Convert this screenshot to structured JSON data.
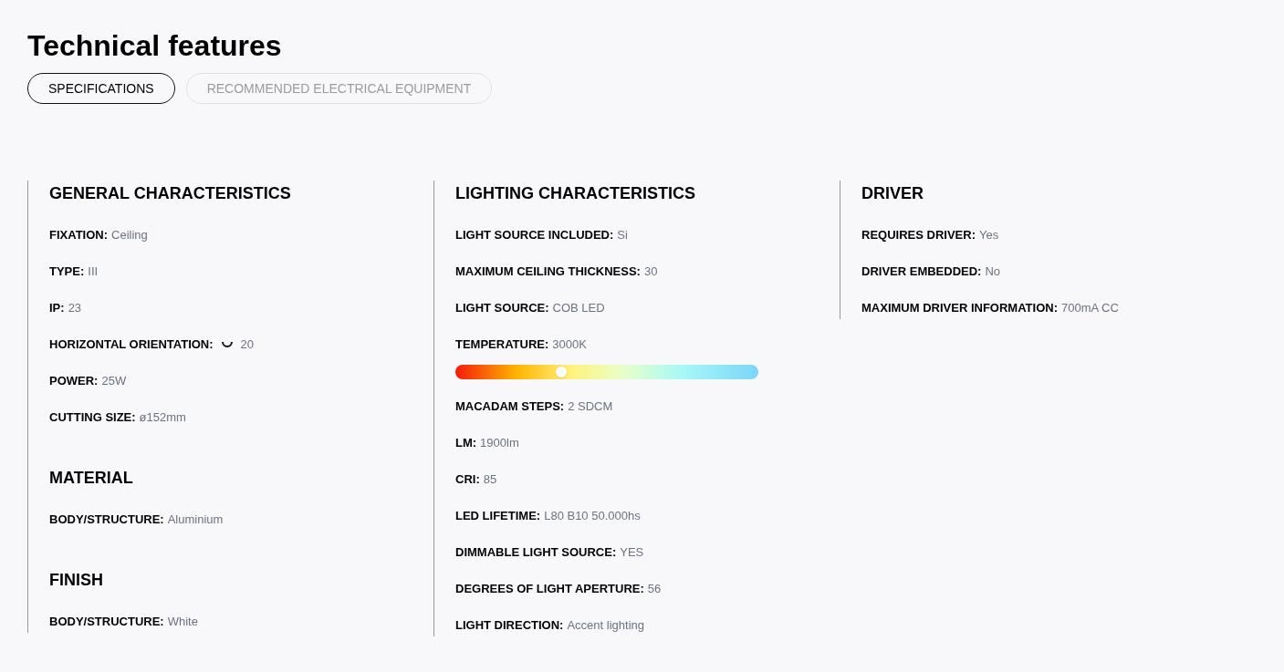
{
  "title": "Technical features",
  "tabs": [
    {
      "label": "SPECIFICATIONS",
      "selected": true
    },
    {
      "label": "RECOMMENDED ELECTRICAL EQUIPMENT",
      "selected": false
    }
  ],
  "columns": [
    {
      "sections": [
        {
          "title": "GENERAL CHARACTERISTICS",
          "rows": [
            {
              "kind": "text",
              "label": "FIXATION:",
              "value": "Ceiling"
            },
            {
              "kind": "text",
              "label": "TYPE:",
              "value": "III"
            },
            {
              "kind": "text",
              "label": "IP:",
              "value": "23"
            },
            {
              "kind": "orientation",
              "label": "HORIZONTAL ORIENTATION:",
              "value": "20"
            },
            {
              "kind": "text",
              "label": "POWER:",
              "value": "25W"
            },
            {
              "kind": "text",
              "label": "CUTTING SIZE:",
              "value": "ø152mm"
            }
          ]
        },
        {
          "title": "MATERIAL",
          "rows": [
            {
              "kind": "text",
              "label": "BODY/STRUCTURE:",
              "value": "Aluminium"
            }
          ]
        },
        {
          "title": "FINISH",
          "rows": [
            {
              "kind": "text",
              "label": "BODY/STRUCTURE:",
              "value": "White"
            }
          ]
        }
      ]
    },
    {
      "sections": [
        {
          "title": "LIGHTING CHARACTERISTICS",
          "rows": [
            {
              "kind": "text",
              "label": "LIGHT SOURCE INCLUDED:",
              "value": "Si"
            },
            {
              "kind": "text",
              "label": "MAXIMUM CEILING THICKNESS:",
              "value": "30"
            },
            {
              "kind": "text",
              "label": "LIGHT SOURCE:",
              "value": "COB LED"
            },
            {
              "kind": "temperature",
              "label": "TEMPERATURE:",
              "value": "3000K",
              "level": 0.35
            },
            {
              "kind": "text",
              "label": "MACADAM STEPS:",
              "value": "2 SDCM"
            },
            {
              "kind": "text",
              "label": "LM:",
              "value": "1900lm"
            },
            {
              "kind": "text",
              "label": "CRI:",
              "value": "85"
            },
            {
              "kind": "text",
              "label": "LED LIFETIME:",
              "value": "L80 B10 50.000hs"
            },
            {
              "kind": "text",
              "label": "DIMMABLE LIGHT SOURCE:",
              "value": "YES"
            },
            {
              "kind": "text",
              "label": "DEGREES OF LIGHT APERTURE:",
              "value": "56"
            },
            {
              "kind": "text",
              "label": "LIGHT DIRECTION:",
              "value": "Accent lighting"
            }
          ]
        }
      ]
    },
    {
      "sections": [
        {
          "title": "DRIVER",
          "rows": [
            {
              "kind": "text",
              "label": "REQUIRES DRIVER:",
              "value": "Yes"
            },
            {
              "kind": "text",
              "label": "DRIVER EMBEDDED:",
              "value": "No"
            },
            {
              "kind": "text",
              "label": "MAXIMUM DRIVER INFORMATION:",
              "value": "700mA CC"
            }
          ]
        }
      ]
    }
  ]
}
